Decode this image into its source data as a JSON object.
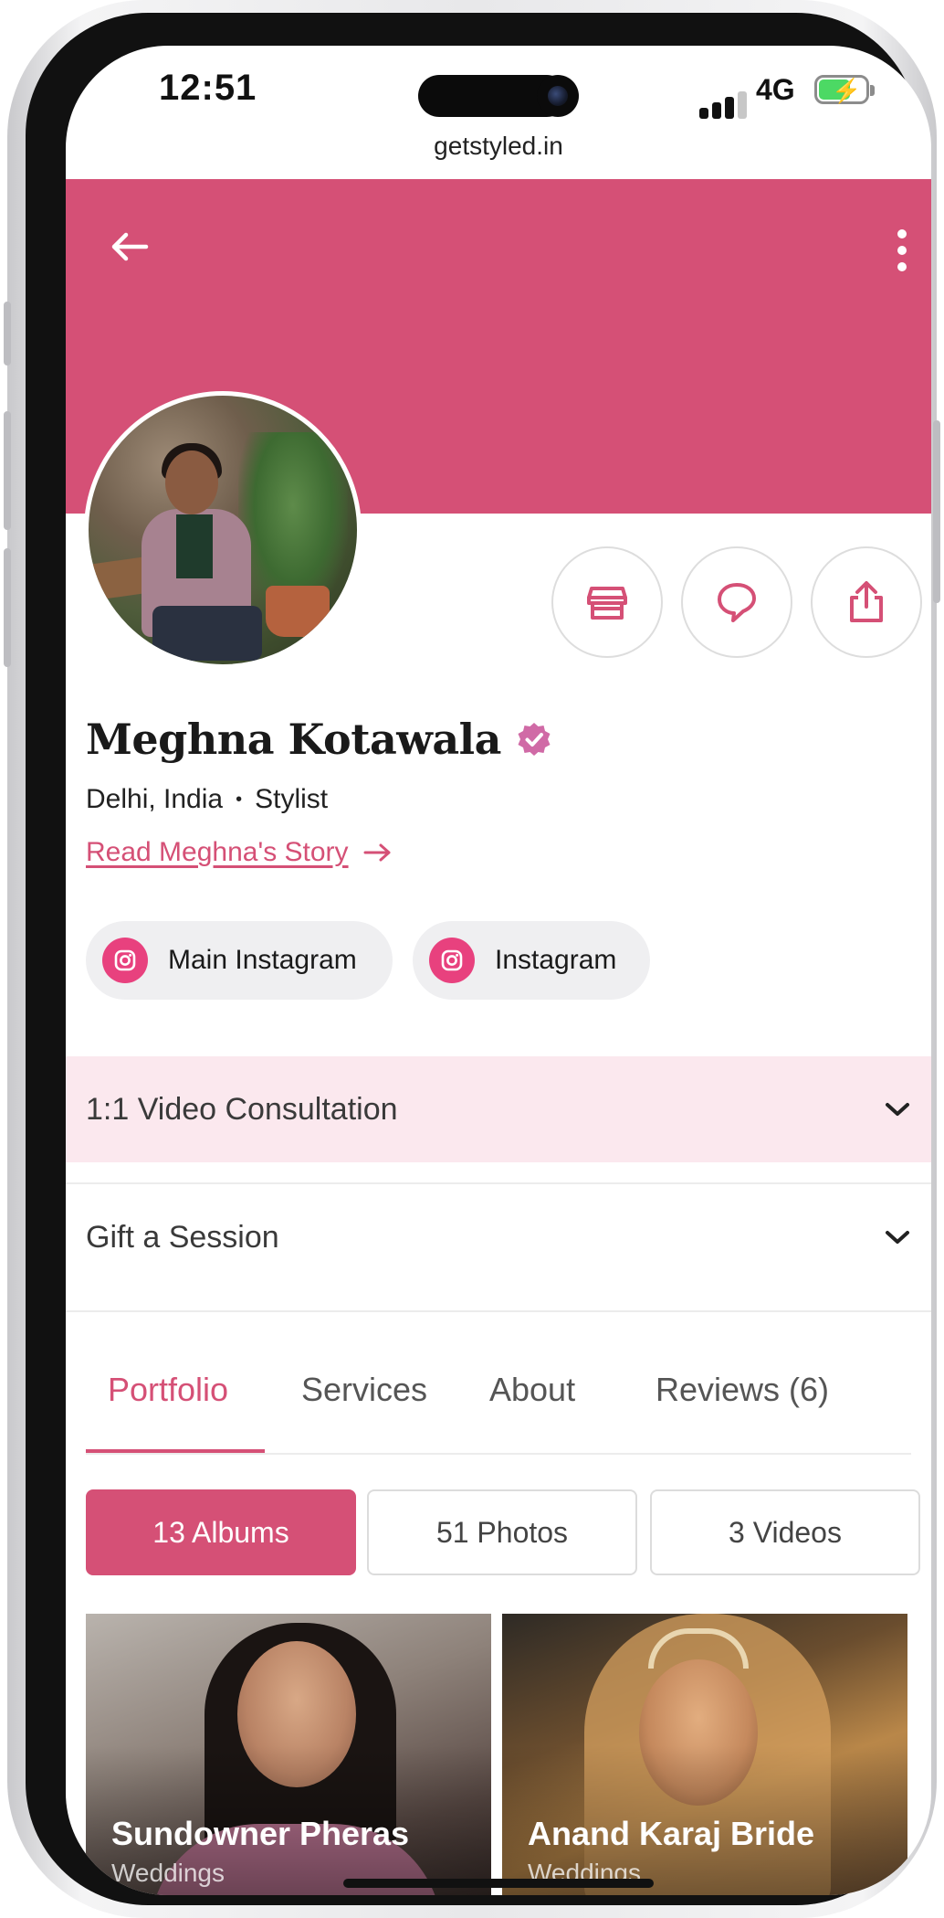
{
  "status_bar": {
    "time": "12:51",
    "network": "4G",
    "battery_charging": true
  },
  "browser": {
    "url": "getstyled.in"
  },
  "header": {
    "brand_color": "#d55076",
    "back_icon": "arrow-left-icon",
    "menu_icon": "more-vertical-icon"
  },
  "profile": {
    "name": "Meghna Kotawala",
    "verified": true,
    "location": "Delhi, India",
    "separator": "•",
    "role": "Stylist",
    "story_link": "Read Meghna's Story",
    "actions": [
      {
        "icon": "store-icon"
      },
      {
        "icon": "chat-bubble-icon"
      },
      {
        "icon": "share-icon"
      }
    ],
    "socials": [
      {
        "label": "Main Instagram",
        "icon": "instagram-icon"
      },
      {
        "label": "Instagram",
        "icon": "instagram-icon"
      }
    ]
  },
  "accordions": [
    {
      "label": "1:1 Video Consultation",
      "highlighted": true
    },
    {
      "label": "Gift a Session",
      "highlighted": false
    }
  ],
  "tabs": [
    {
      "label": "Portfolio",
      "active": true
    },
    {
      "label": "Services",
      "active": false
    },
    {
      "label": "About",
      "active": false
    },
    {
      "label": "Reviews (6)",
      "active": false
    }
  ],
  "segments": [
    {
      "label": "13 Albums",
      "active": true
    },
    {
      "label": "51 Photos",
      "active": false
    },
    {
      "label": "3 Videos",
      "active": false
    }
  ],
  "albums": [
    {
      "title": "Sundowner Pheras",
      "category": "Weddings"
    },
    {
      "title": "Anand Karaj Bride",
      "category": "Weddings"
    }
  ],
  "colors": {
    "accent": "#d55076",
    "accordion_highlight": "#fbe8ee",
    "instagram": "#e8417e",
    "pill_bg": "#efeff1"
  }
}
